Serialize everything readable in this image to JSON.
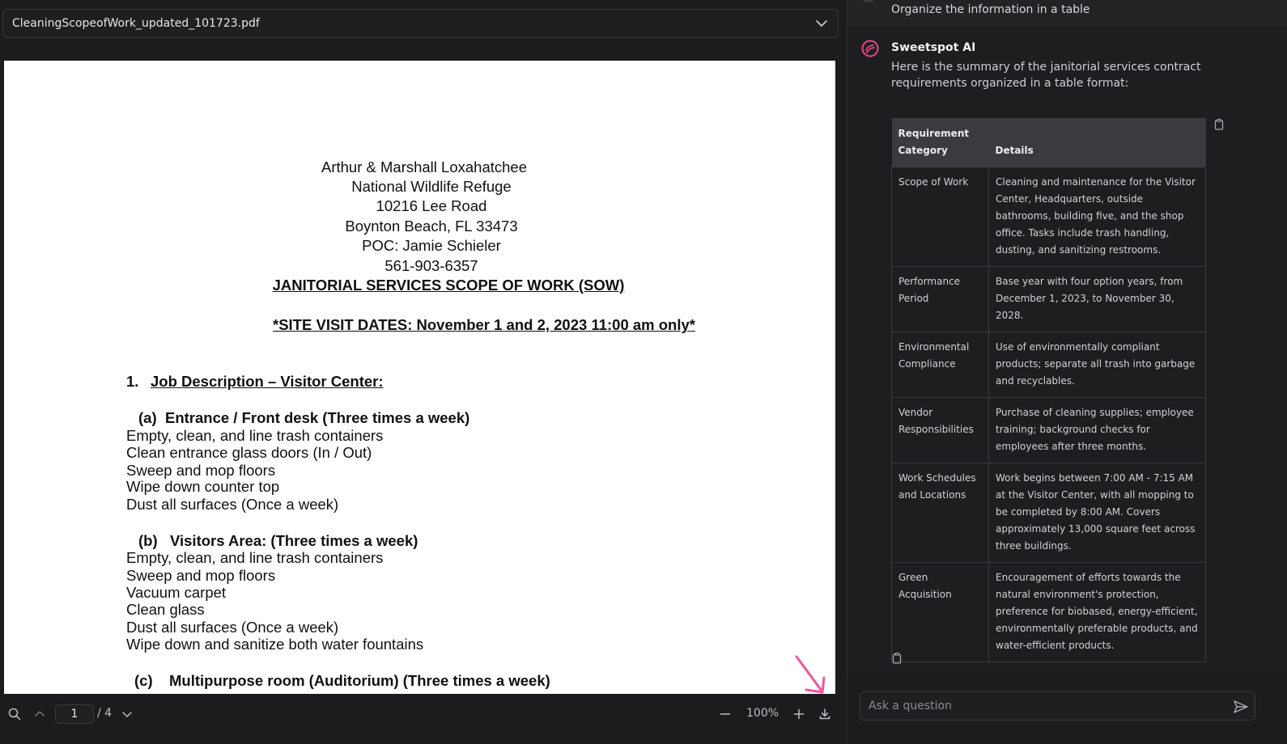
{
  "pdf_viewer": {
    "file_name": "CleaningScopeofWork_updated_101723.pdf",
    "page_current": "1",
    "page_total": "/ 4",
    "zoom": "100%",
    "document": {
      "header_lines": [
        "Arthur & Marshall Loxahatchee",
        "National Wildlife Refuge",
        "10216 Lee Road",
        "Boynton Beach, FL 33473",
        "POC: Jamie Schieler",
        "561-903-6357"
      ],
      "title": "JANITORIAL SERVICES SCOPE OF WORK (SOW)",
      "site_visit": "*SITE VISIT DATES: November 1 and 2, 2023 11:00 am only*",
      "section_number": "1.",
      "section_title": "Job Description – Visitor Center:",
      "sub_a_label": "(a)",
      "sub_a_title": "Entrance / Front desk (Three times a week)",
      "sub_a_items": [
        "Empty, clean, and line trash containers",
        "Clean entrance glass doors (In / Out)",
        "Sweep and mop floors",
        "Wipe down counter top",
        "Dust all surfaces (Once a week)"
      ],
      "sub_b_label": "(b)",
      "sub_b_title": "Visitors Area: (Three times a week)",
      "sub_b_items": [
        "Empty, clean, and line trash containers",
        "Sweep and mop floors",
        "Vacuum carpet",
        "Clean glass",
        "Dust all surfaces (Once a week)",
        "Wipe down and sanitize both water fountains"
      ],
      "sub_c_label": "(c)",
      "sub_c_title": "Multipurpose room (Auditorium) (Three times a week)"
    }
  },
  "chat": {
    "user_message": "Organize the information in a table",
    "assistant_name": "Sweetspot AI",
    "assistant_intro": "Here is the summary of the janitorial services contract requirements organized in a table format:",
    "table": {
      "headers": [
        "Requirement Category",
        "Details"
      ],
      "rows": [
        [
          "Scope of Work",
          "Cleaning and maintenance for the Visitor Center, Headquarters, outside bathrooms, building five, and the shop office. Tasks include trash handling, dusting, and sanitizing restrooms."
        ],
        [
          "Performance Period",
          "Base year with four option years, from December 1, 2023, to November 30, 2028."
        ],
        [
          "Environmental Compliance",
          "Use of environmentally compliant products; separate all trash into garbage and recyclables."
        ],
        [
          "Vendor Responsibilities",
          "Purchase of cleaning supplies; employee training; background checks for employees after three months."
        ],
        [
          "Work Schedules and Locations",
          "Work begins between 7:00 AM - 7:15 AM at the Visitor Center, with all mopping to be completed by 8:00 AM. Covers approximately 13,000 square feet across three buildings."
        ],
        [
          "Green Acquisition",
          "Encouragement of efforts towards the natural environment's protection, preference for biobased, energy-efficient, environmentally preferable products, and water-efficient products."
        ]
      ]
    },
    "input_placeholder": "Ask a question"
  },
  "colors": {
    "brand_accent": "#e8488a",
    "annotation_arrow": "#f0569e",
    "background": "#1c1c1e"
  },
  "icons": [
    "chevron-down-icon",
    "search-icon",
    "chevron-up-icon",
    "zoom-out-icon",
    "zoom-in-icon",
    "download-icon",
    "clipboard-icon",
    "send-icon",
    "sweetspot-logo-icon",
    "annotation-arrow"
  ]
}
